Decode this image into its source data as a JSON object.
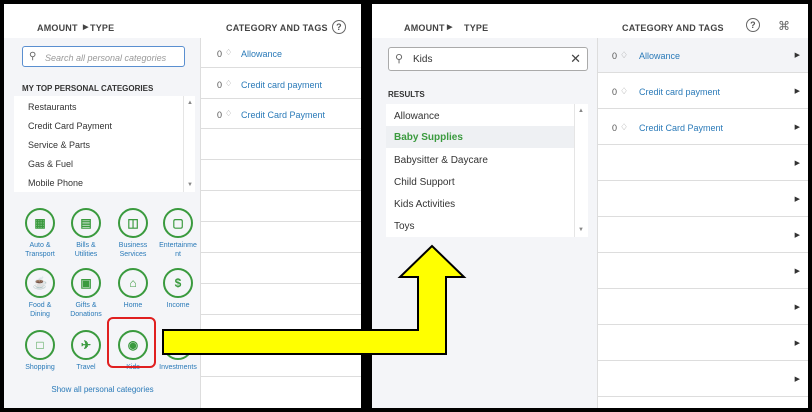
{
  "left_panel": {
    "header": {
      "amount": "AMOUNT",
      "type": "TYPE",
      "category": "CATEGORY AND TAGS",
      "help": "?"
    },
    "search_placeholder": "Search all personal categories",
    "section_title": "MY TOP PERSONAL CATEGORIES",
    "top_categories": [
      "Restaurants",
      "Credit Card Payment",
      "Service & Parts",
      "Gas & Fuel",
      "Mobile Phone"
    ],
    "tiles": [
      {
        "label": "Auto & Transport",
        "icon": "car-icon"
      },
      {
        "label": "Bills & Utilities",
        "icon": "bills-icon"
      },
      {
        "label": "Business Services",
        "icon": "business-icon"
      },
      {
        "label": "Entertainment",
        "icon": "ticket-icon"
      },
      {
        "label": "Food & Dining",
        "icon": "coffee-icon"
      },
      {
        "label": "Gifts & Donations",
        "icon": "gift-icon"
      },
      {
        "label": "Home",
        "icon": "house-icon"
      },
      {
        "label": "Income",
        "icon": "money-bag-icon"
      },
      {
        "label": "Shopping",
        "icon": "shopping-bag-icon"
      },
      {
        "label": "Travel",
        "icon": "airplane-icon"
      },
      {
        "label": "Kids",
        "icon": "stroller-icon"
      },
      {
        "label": "Investments",
        "icon": "chart-icon"
      }
    ],
    "tile_lines": [
      [
        "Auto &",
        "Transport"
      ],
      [
        "Bills &",
        "Utilities"
      ],
      [
        "Business",
        "Services"
      ],
      [
        "Entertainme",
        "nt"
      ],
      [
        "Food &",
        "Dining"
      ],
      [
        "Gifts &",
        "Donations"
      ],
      [
        "Home"
      ],
      [
        "Income"
      ],
      [
        "Shopping"
      ],
      [
        "Travel"
      ],
      [
        "Kids"
      ],
      [
        "Investments"
      ]
    ],
    "show_all": "Show all personal categories",
    "rows": [
      {
        "count": "0",
        "category": "Allowance"
      },
      {
        "count": "0",
        "category": "Credit card payment"
      },
      {
        "count": "0",
        "category": "Credit Card Payment"
      }
    ]
  },
  "right_panel": {
    "header": {
      "amount": "AMOUNT",
      "type": "TYPE",
      "category": "CATEGORY AND TAGS",
      "help": "?"
    },
    "search_value": "Kids",
    "results_title": "RESULTS",
    "results": [
      "Allowance",
      "Baby Supplies",
      "Babysitter & Daycare",
      "Child Support",
      "Kids Activities",
      "Toys"
    ],
    "highlighted_result": "Baby Supplies",
    "rows": [
      {
        "count": "0",
        "category": "Allowance"
      },
      {
        "count": "0",
        "category": "Credit card payment"
      },
      {
        "count": "0",
        "category": "Credit Card Payment"
      }
    ]
  },
  "colors": {
    "accent_green": "#3a9a3e",
    "link_blue": "#2a7ab8",
    "arrow_yellow": "#ffff00",
    "callout_red": "#e02020"
  }
}
